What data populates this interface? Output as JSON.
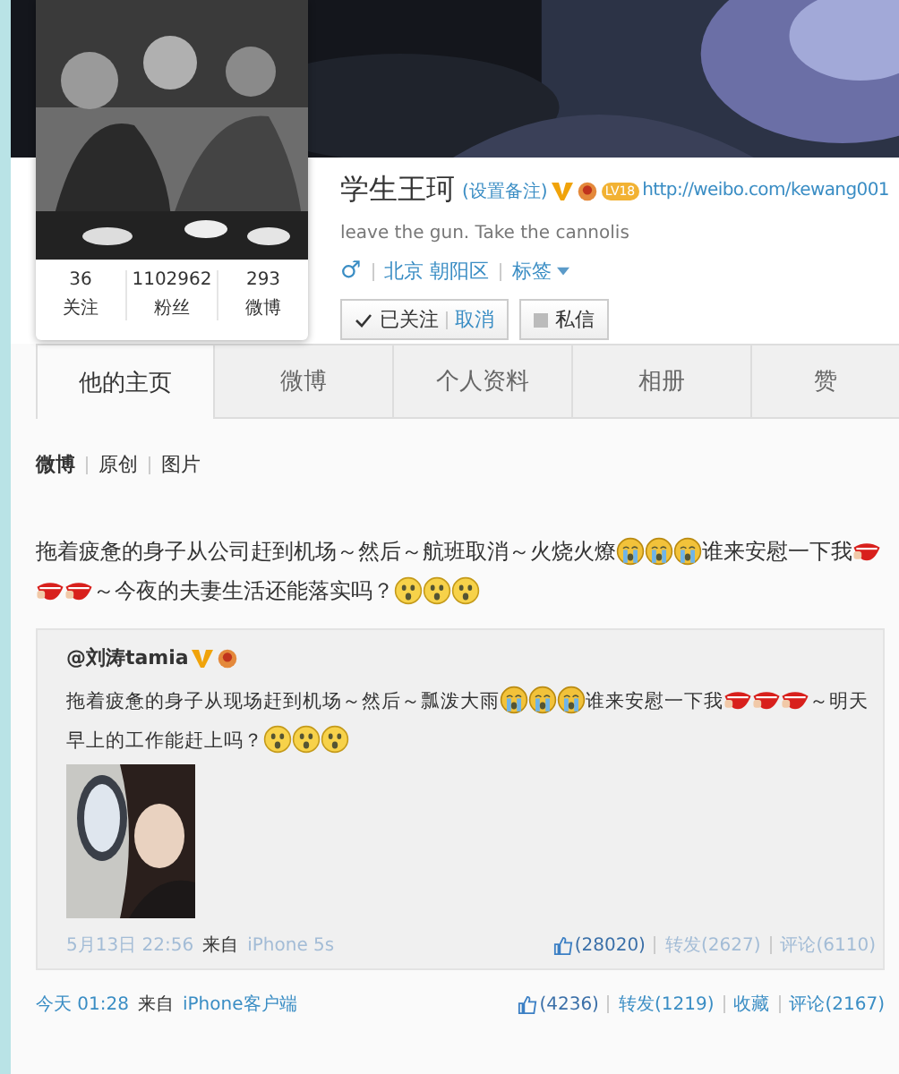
{
  "profile": {
    "name": "学生王珂",
    "remark_link": "(设置备注)",
    "level_badge": "LV18",
    "homepage": "http://weibo.com/kewang001",
    "bio": "leave the gun. Take the cannolis",
    "gender": "♂",
    "location": "北京 朝阳区",
    "tags_link": "标签",
    "follow_label": "已关注",
    "unfollow_link": "取消",
    "message_button": "私信"
  },
  "stats": [
    {
      "value": "36",
      "label": "关注"
    },
    {
      "value": "1102962",
      "label": "粉丝"
    },
    {
      "value": "293",
      "label": "微博"
    }
  ],
  "tabs": [
    {
      "label": "他的主页",
      "selected": true
    },
    {
      "label": "微博",
      "selected": false
    },
    {
      "label": "个人资料",
      "selected": false
    },
    {
      "label": "相册",
      "selected": false
    },
    {
      "label": "赞",
      "selected": false
    }
  ],
  "filters": [
    {
      "label": "微博",
      "selected": true
    },
    {
      "label": "原创",
      "selected": false
    },
    {
      "label": "图片",
      "selected": false
    }
  ],
  "post": {
    "content": [
      {
        "kind": "text",
        "text": "拖着疲惫的身子从公司赶到机场～然后～航班取消～火烧火燎"
      },
      {
        "kind": "crying"
      },
      {
        "kind": "crying"
      },
      {
        "kind": "crying"
      },
      {
        "kind": "text",
        "text": "谁来安慰一下我"
      },
      {
        "kind": "mouth"
      },
      {
        "kind": "mouth"
      },
      {
        "kind": "mouth"
      },
      {
        "kind": "text",
        "text": "～今夜的夫妻生活还能落实吗？"
      },
      {
        "kind": "shocked"
      },
      {
        "kind": "shocked"
      },
      {
        "kind": "shocked"
      }
    ],
    "repost": {
      "author": "@刘涛tamia",
      "content": [
        {
          "kind": "text",
          "text": "拖着疲惫的身子从现场赶到机场～然后～瓢泼大雨"
        },
        {
          "kind": "crying"
        },
        {
          "kind": "crying"
        },
        {
          "kind": "crying"
        },
        {
          "kind": "text",
          "text": "谁来安慰一下我"
        },
        {
          "kind": "mouth"
        },
        {
          "kind": "mouth"
        },
        {
          "kind": "mouth"
        },
        {
          "kind": "text",
          "text": "～明天"
        },
        {
          "kind": "text",
          "text": "早上的工作能赶上吗？"
        },
        {
          "kind": "shocked"
        },
        {
          "kind": "shocked"
        },
        {
          "kind": "shocked"
        }
      ],
      "time": "5月13日 22:56",
      "source_prefix": "来自",
      "source": "iPhone 5s",
      "likes": "(28020)",
      "reposts": "转发(2627)",
      "comments": "评论(6110)"
    },
    "time": "今天 01:28",
    "source_prefix": "来自",
    "source": "iPhone客户端",
    "likes": "(4236)",
    "reposts": "转发(1219)",
    "favorite": "收藏",
    "comments": "评论(2167)"
  }
}
